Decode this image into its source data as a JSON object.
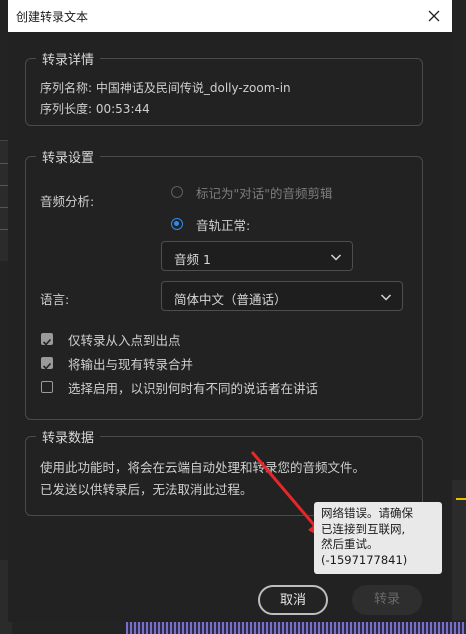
{
  "dialog": {
    "title": "创建转录文本"
  },
  "details": {
    "legend": "转录详情",
    "sequence_name": "序列名称: 中国神话及民间传说_dolly-zoom-in",
    "sequence_length": "序列长度: 00:53:44"
  },
  "settings": {
    "legend": "转录设置",
    "audio_analysis_label": "音频分析:",
    "radio_dialogue": "标记为\"对话\"的音频剪辑",
    "radio_normal": "音轨正常:",
    "audio_track_value": "音频 1",
    "language_label": "语言:",
    "language_value": "简体中文（普通话）",
    "check_in_out": "仅转录从入点到出点",
    "check_merge": "将输出与现有转录合并",
    "check_speakers": "选择启用，以识别何时有不同的说话者在讲话"
  },
  "data": {
    "legend": "转录数据",
    "desc_line1": "使用此功能时，将会在云端自动处理和转录您的音频文件。",
    "desc_line2": "已发送以供转录后，无法取消此过程。"
  },
  "tooltip": {
    "line1": "网络错误。请确保",
    "line2": "已连接到互联网,",
    "line3": "然后重试。",
    "line4": "(-1597177841)"
  },
  "buttons": {
    "cancel": "取消",
    "transcribe": "转录"
  },
  "colors": {
    "accent": "#2d8ceb",
    "arrow": "#e8262a",
    "dialog_bg": "#222222"
  }
}
